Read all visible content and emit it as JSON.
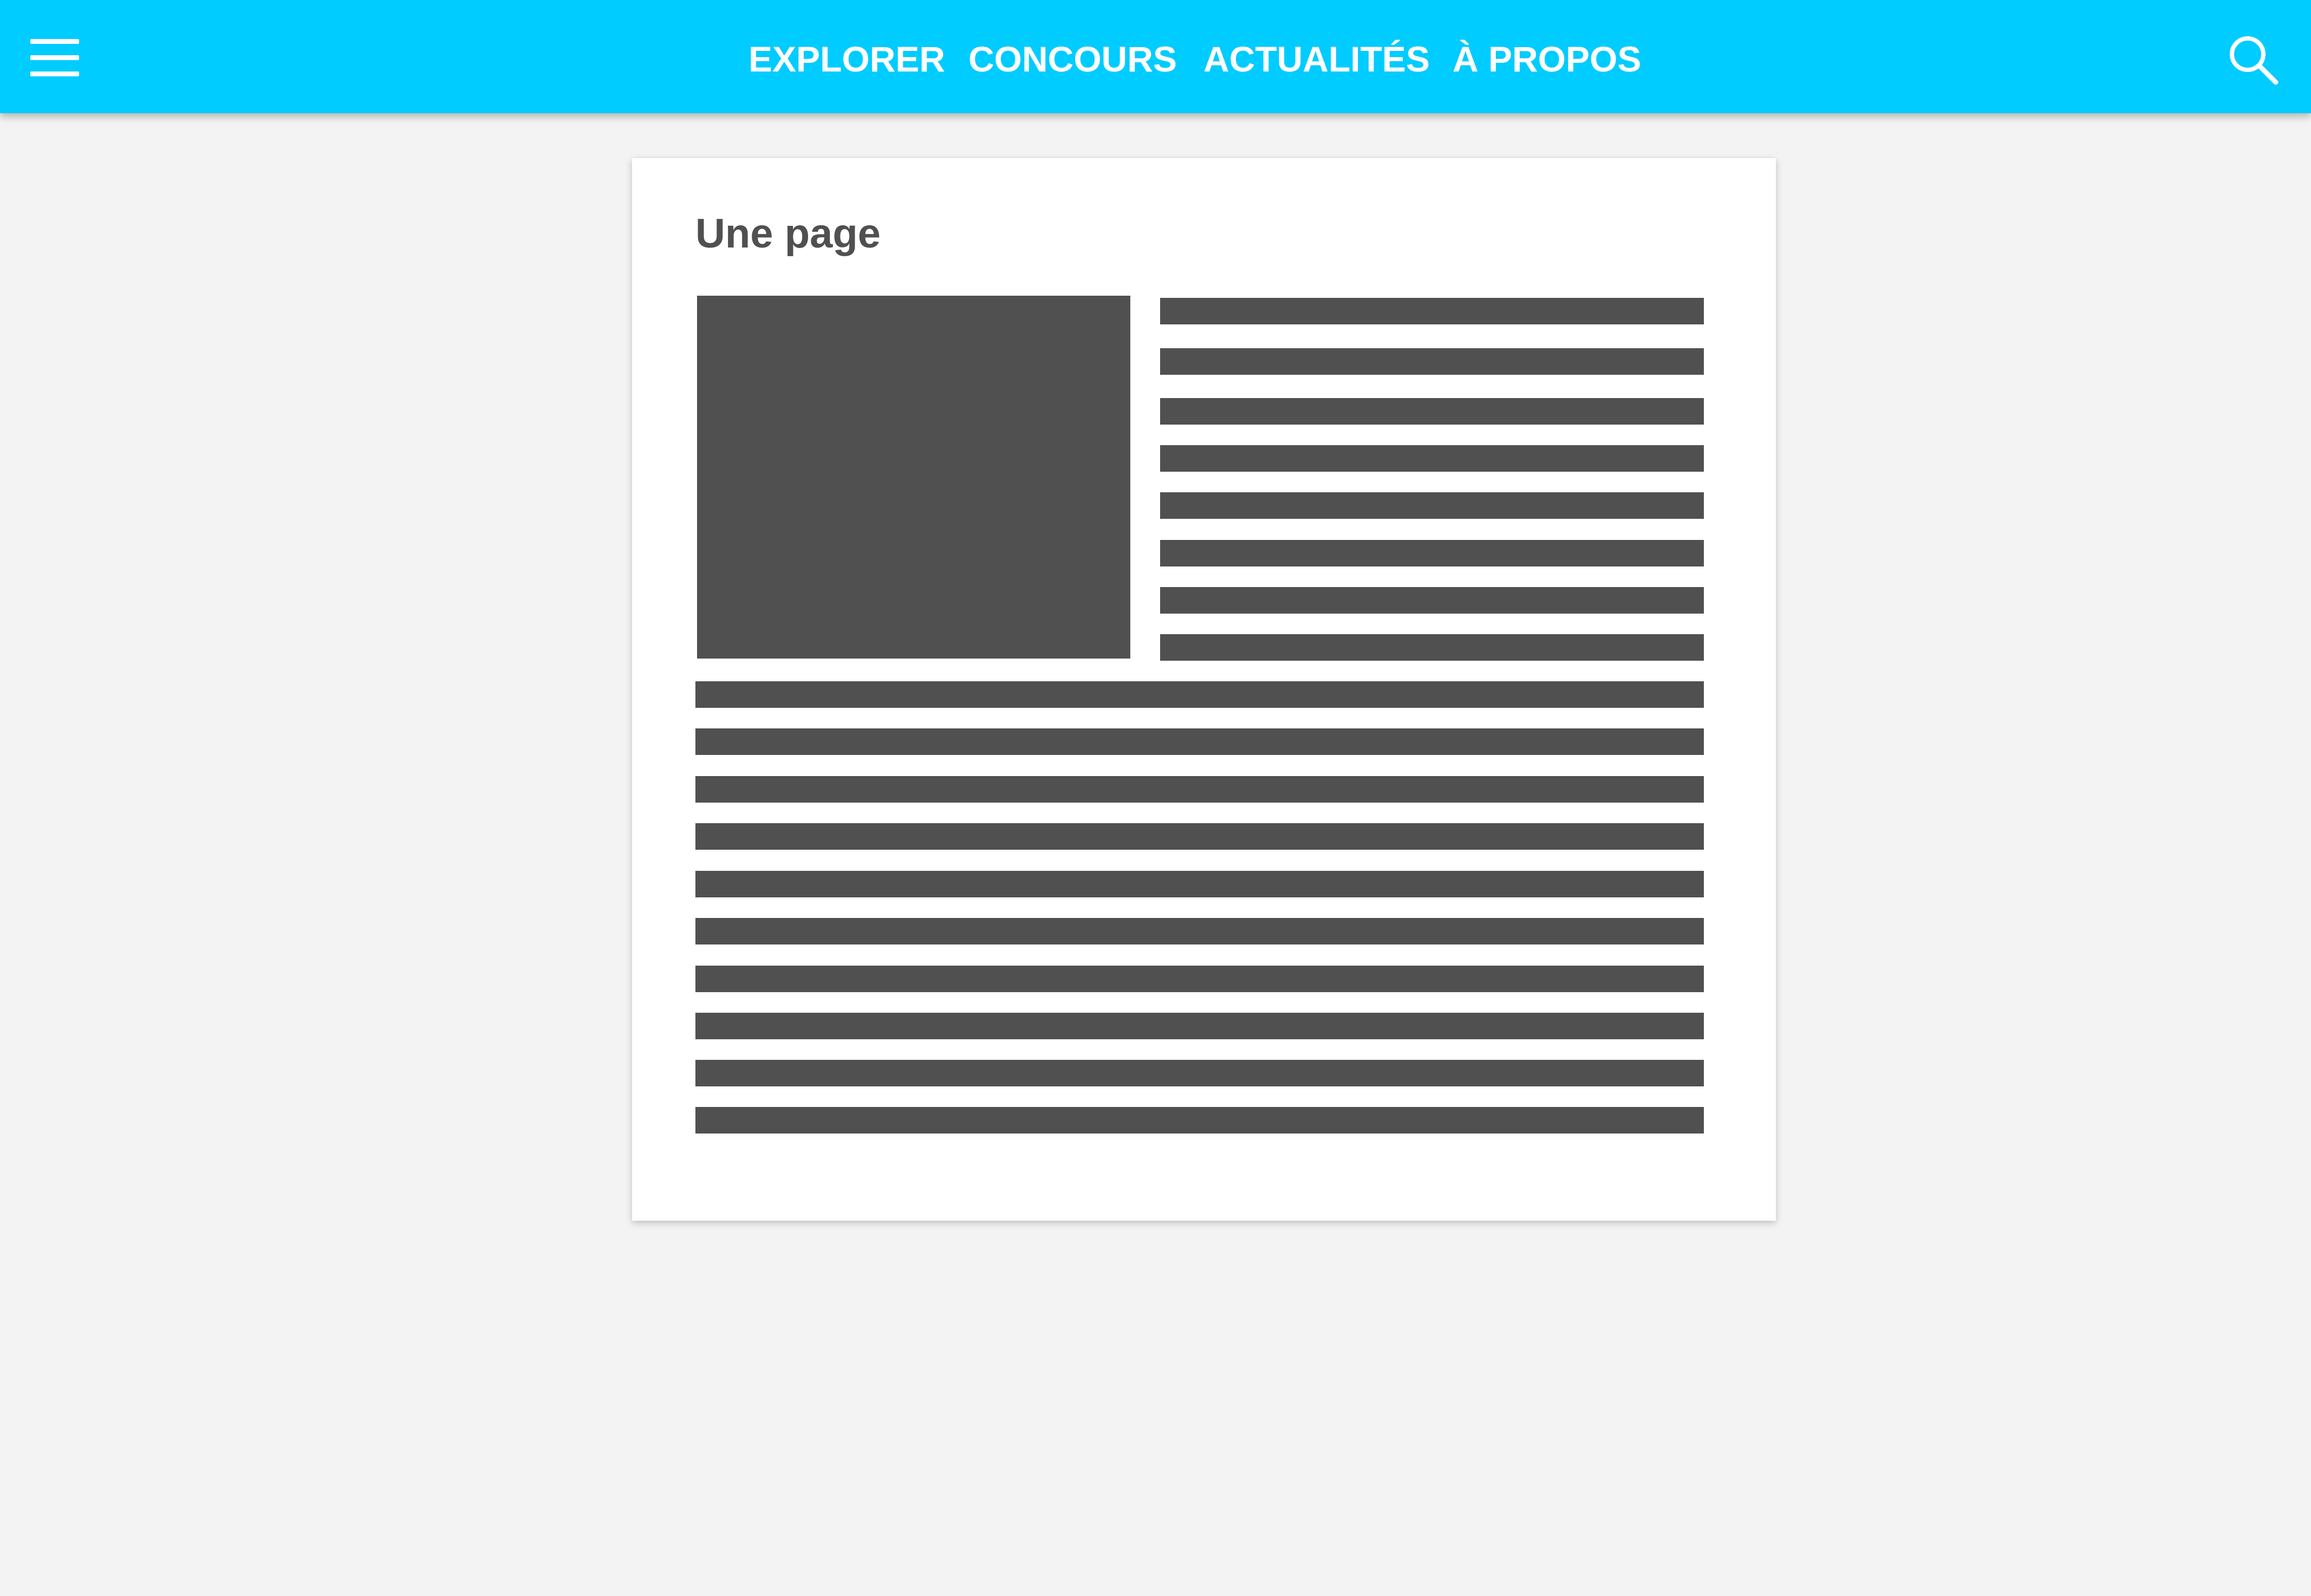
{
  "header": {
    "nav": [
      {
        "label": "EXPLORER"
      },
      {
        "label": "CONCOURS"
      },
      {
        "label": "ACTUALITÉS"
      },
      {
        "label": "À PROPOS"
      }
    ],
    "menu_icon": "hamburger-menu-icon",
    "search_icon": "search-icon",
    "background_color": "#00ccff",
    "text_color": "#ffffff"
  },
  "card": {
    "title": "Une page",
    "placeholder_color": "#505050"
  }
}
